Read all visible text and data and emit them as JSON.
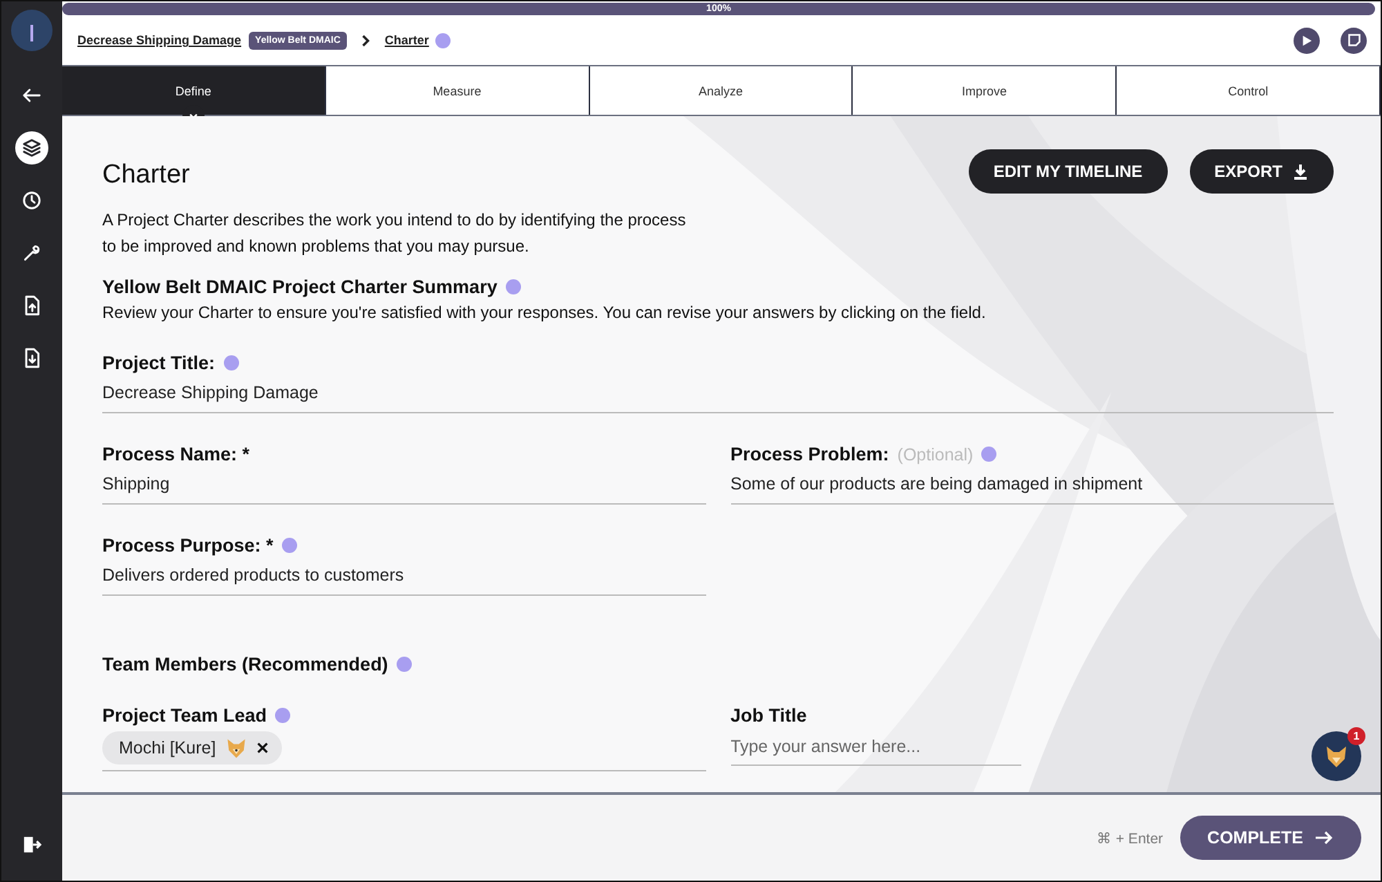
{
  "progress": {
    "label": "100%",
    "level": 1
  },
  "breadcrumb": {
    "project": "Decrease Shipping Damage",
    "badge": "Yellow Belt DMAIC",
    "page": "Charter"
  },
  "sidebar": {
    "items": [
      {
        "kind": "back",
        "selected": false
      },
      {
        "kind": "layers",
        "selected": true
      },
      {
        "kind": "history",
        "selected": false
      },
      {
        "kind": "tools",
        "selected": false
      },
      {
        "kind": "upload",
        "selected": false
      },
      {
        "kind": "download",
        "selected": false
      }
    ]
  },
  "tabs": [
    {
      "label": "Define",
      "selected": true
    },
    {
      "label": "Measure",
      "selected": false
    },
    {
      "label": "Analyze",
      "selected": false
    },
    {
      "label": "Improve",
      "selected": false
    },
    {
      "label": "Control",
      "selected": false
    }
  ],
  "page": {
    "title": "Charter",
    "buttons": [
      {
        "label": "EDIT MY TIMELINE",
        "kind": "plain"
      },
      {
        "label": "EXPORT",
        "kind": "download"
      }
    ],
    "intro": "A Project Charter describes the work you intend to do by identifying the process to be improved and known problems that you may pursue.",
    "summary_title": "Yellow Belt DMAIC Project Charter Summary",
    "summary_text": "Review your Charter to ensure you're satisfied with your responses. You can revise your answers by clicking on the field."
  },
  "rows": [
    {
      "kind": "fields",
      "fields": [
        {
          "label": "Project Title:",
          "info": true,
          "value": "Decrease Shipping Damage",
          "kind": "full"
        }
      ]
    },
    {
      "kind": "fields",
      "fields": [
        {
          "label": "Process Name: *",
          "info": false,
          "value": "Shipping",
          "kind": "half"
        },
        {
          "label": "Process Problem:",
          "optional": "(Optional)",
          "info": true,
          "value": "Some of our products are being damaged in shipment",
          "kind": "half"
        }
      ]
    },
    {
      "kind": "fields",
      "fields": [
        {
          "label": "Process Purpose: *",
          "info": true,
          "value": "Delivers ordered products to customers",
          "kind": "half"
        }
      ]
    },
    {
      "kind": "heading",
      "title": "Team Members (Recommended)",
      "info": true
    },
    {
      "kind": "fields",
      "fields": [
        {
          "label": "Project Team Lead",
          "info": true,
          "chip": "Mochi [Kure]",
          "kind": "chip"
        },
        {
          "label": "Job Title",
          "info": false,
          "placeholder": "Type your answer here...",
          "kind": "input"
        }
      ]
    }
  ],
  "chat": {
    "badge": "1"
  },
  "footer": {
    "shortcut": "⌘ + Enter",
    "button": "COMPLETE"
  }
}
